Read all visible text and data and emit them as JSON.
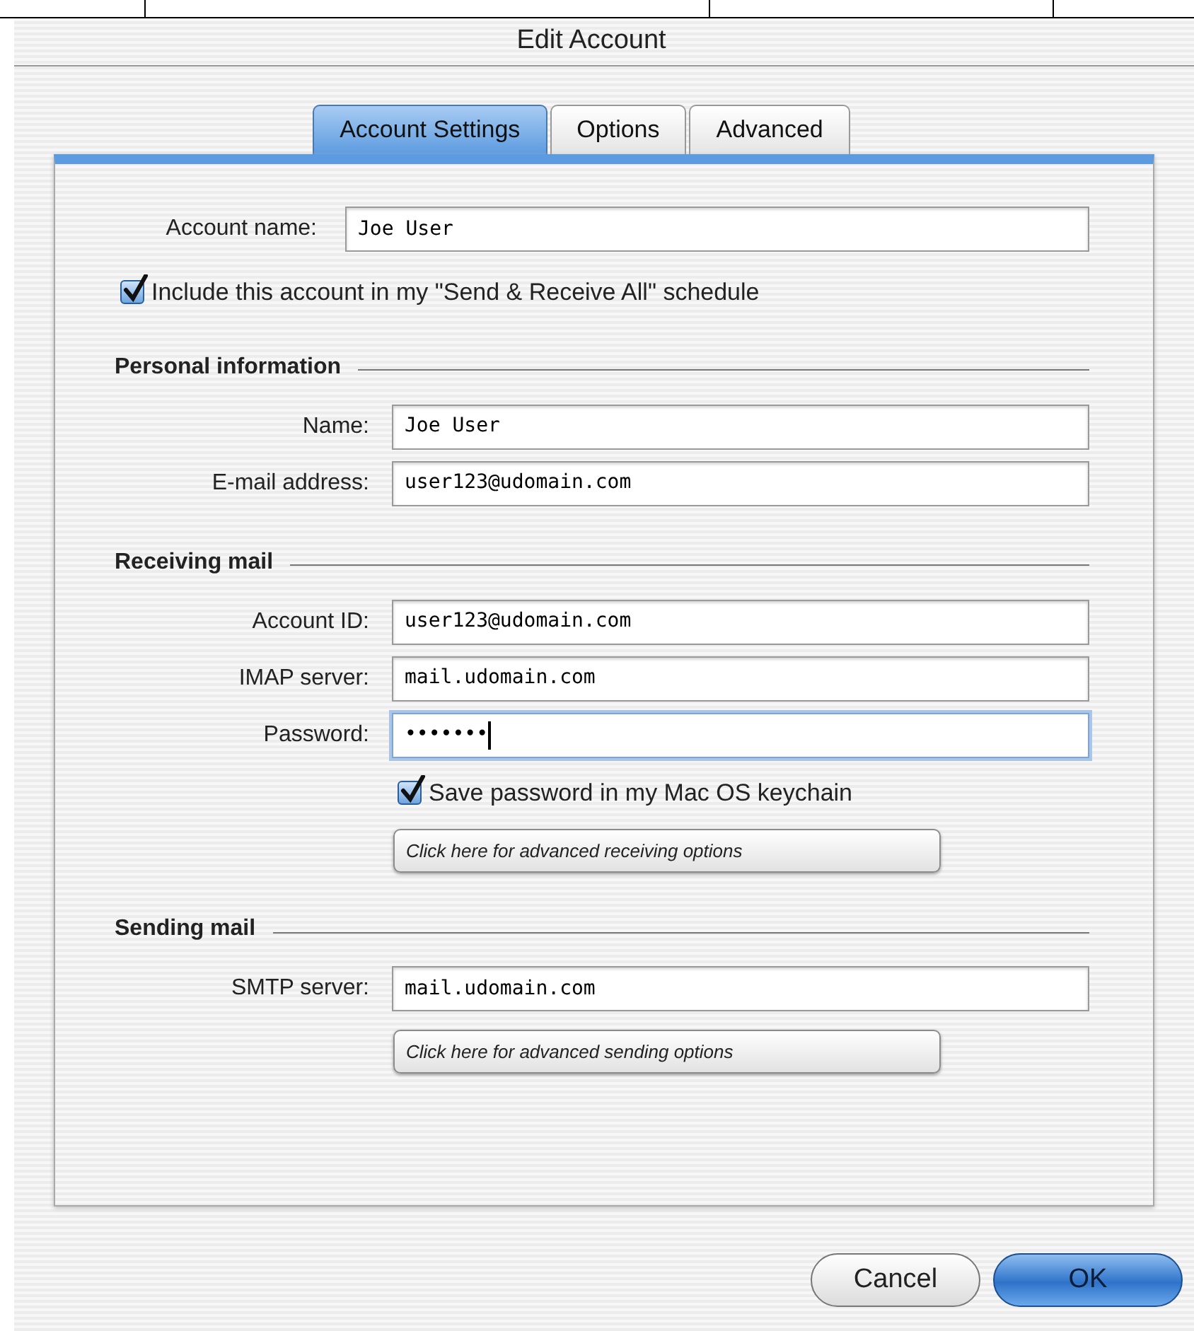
{
  "window": {
    "title": "Edit Account"
  },
  "tabs": [
    {
      "label": "Account Settings",
      "selected": true
    },
    {
      "label": "Options",
      "selected": false
    },
    {
      "label": "Advanced",
      "selected": false
    }
  ],
  "account_name": {
    "label": "Account name:",
    "value": "Joe User"
  },
  "include_schedule": {
    "label": "Include this account in my \"Send & Receive All\" schedule",
    "checked": true
  },
  "sections": [
    {
      "title": "Personal information",
      "fields": [
        {
          "label": "Name:",
          "value": "Joe User",
          "focused": false
        },
        {
          "label": "E-mail address:",
          "value": "user123@udomain.com",
          "focused": false
        }
      ]
    },
    {
      "title": "Receiving mail",
      "fields": [
        {
          "label": "Account ID:",
          "value": "user123@udomain.com",
          "focused": false
        },
        {
          "label": "IMAP server:",
          "value": "mail.udomain.com",
          "focused": false
        },
        {
          "label": "Password:",
          "value": "•••••••",
          "focused": true
        }
      ],
      "checkbox": {
        "label": "Save password in my Mac OS keychain",
        "checked": true
      },
      "button": "Click here for advanced receiving options"
    },
    {
      "title": "Sending mail",
      "fields": [
        {
          "label": "SMTP server:",
          "value": "mail.udomain.com",
          "focused": false
        }
      ],
      "button": "Click here for advanced sending options"
    }
  ],
  "buttons": [
    {
      "label": "Cancel",
      "default": false
    },
    {
      "label": "OK",
      "default": true
    }
  ]
}
